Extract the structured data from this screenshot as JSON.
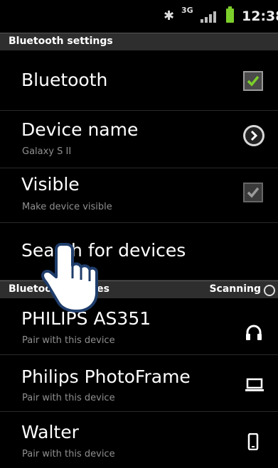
{
  "status_bar": {
    "bluetooth_icon": "bluetooth-icon",
    "network": "3G",
    "time": "12:38"
  },
  "sections": {
    "settings_title": "Bluetooth settings",
    "devices_title": "Bluetooth devices",
    "scanning_label": "Scanning"
  },
  "settings": {
    "bluetooth": {
      "label": "Bluetooth",
      "checked": true
    },
    "device_name": {
      "label": "Device name",
      "value": "Galaxy S II"
    },
    "visible": {
      "label": "Visible",
      "subtitle": "Make device visible",
      "checked": true
    },
    "search": {
      "label": "Search for devices"
    }
  },
  "devices": [
    {
      "name": "PHILIPS AS351",
      "subtitle": "Pair with this device",
      "icon": "headphones-icon"
    },
    {
      "name": "Philips PhotoFrame",
      "subtitle": "Pair with this device",
      "icon": "laptop-icon"
    },
    {
      "name": "Walter",
      "subtitle": "Pair with this device",
      "icon": "phone-icon"
    }
  ],
  "colors": {
    "checkmark": "#7ccf2a",
    "subtitle": "#8f8f8f",
    "section_bg": "#2e2e2e"
  }
}
